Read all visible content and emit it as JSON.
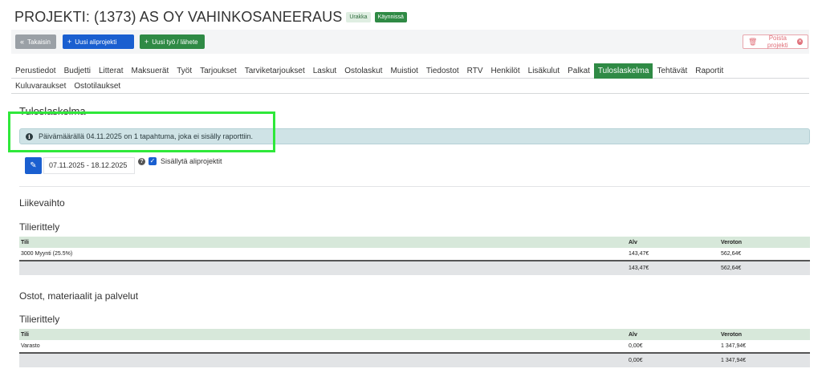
{
  "header": {
    "title": "PROJEKTI: (1373) AS OY VAHINKOSANEERAUS",
    "badge_type": "Urakka",
    "badge_status": "Käynnissä"
  },
  "toolbar": {
    "back_label": "Takaisin",
    "new_subproject_label": "Uusi aliprojekti",
    "new_work_label": "Uusi työ / lähete",
    "delete_label": "Poista projekti"
  },
  "tabs": {
    "row1": [
      {
        "label": "Perustiedot"
      },
      {
        "label": "Budjetti"
      },
      {
        "label": "Litterat"
      },
      {
        "label": "Maksuerät"
      },
      {
        "label": "Työt"
      },
      {
        "label": "Tarjoukset"
      },
      {
        "label": "Tarviketarjoukset"
      },
      {
        "label": "Laskut"
      },
      {
        "label": "Ostolaskut"
      },
      {
        "label": "Muistiot"
      },
      {
        "label": "Tiedostot"
      },
      {
        "label": "RTV"
      },
      {
        "label": "Henkilöt"
      },
      {
        "label": "Lisäkulut"
      },
      {
        "label": "Palkat"
      },
      {
        "label": "Tuloslaskelma"
      },
      {
        "label": "Tehtävät"
      },
      {
        "label": "Raportit"
      }
    ],
    "row2": [
      {
        "label": "Kuluvaraukset"
      },
      {
        "label": "Ostotilaukset"
      }
    ],
    "active": "Tuloslaskelma"
  },
  "report": {
    "title": "Tuloslaskelma",
    "alert_text": "Päivämäärällä 04.11.2025 on 1 tapahtuma, joka ei sisälly raporttiin.",
    "date_range": "07.11.2025 - 18.12.2025",
    "include_subprojects_label": "Sisällytä aliprojektit",
    "include_subprojects_checked": true
  },
  "sections": {
    "revenue": {
      "title": "Liikevaihto",
      "subtitle": "Tilierittely",
      "columns": [
        "Tili",
        "Alv",
        "Veroton"
      ],
      "rows": [
        {
          "account": "3000 Myynti (25.5%)",
          "vat": "143,47€",
          "net": "562,64€"
        }
      ],
      "total": {
        "vat": "143,47€",
        "net": "562,64€"
      }
    },
    "purchases": {
      "title": "Ostot, materiaalit ja palvelut",
      "subtitle": "Tilierittely",
      "columns": [
        "Tili",
        "Alv",
        "Veroton"
      ],
      "rows": [
        {
          "account": "Varasto",
          "vat": "0,00€",
          "net": "1 347,94€"
        }
      ],
      "total": {
        "vat": "0,00€",
        "net": "1 347,94€"
      }
    }
  },
  "colors": {
    "primary": "#1a5fd0",
    "success": "#2f8a45",
    "highlight": "#2fe83a",
    "alert_bg": "#cfe3e6",
    "table_head": "#d7e8da"
  }
}
